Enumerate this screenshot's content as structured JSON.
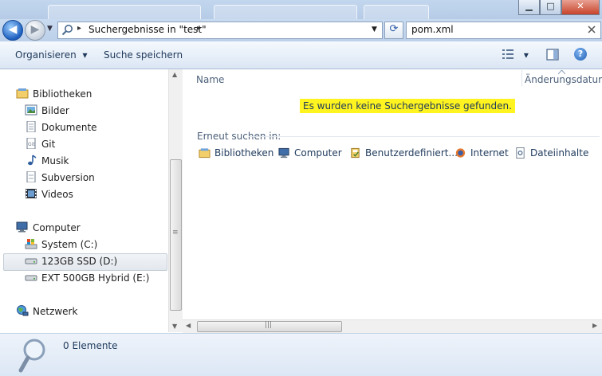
{
  "titlebar": {
    "window_controls": {
      "minimize": "▁",
      "maximize": "□",
      "close": "✕"
    }
  },
  "addressbar": {
    "back_glyph": "◀",
    "forward_glyph": "▶",
    "path_separator": "▸",
    "path": "Suchergebnisse in \"test\"",
    "path_tail": "▸",
    "dropdown_glyph": "▼",
    "refresh_glyph": "⟳",
    "search_query": "pom.xml"
  },
  "toolbar": {
    "organize": "Organisieren",
    "organize_caret": "▾",
    "save_search": "Suche speichern",
    "view_caret": "▾",
    "help": "?"
  },
  "nav": {
    "libraries": "Bibliotheken",
    "library_items": [
      "Bilder",
      "Dokumente",
      "Git",
      "Musik",
      "Subversion",
      "Videos"
    ],
    "computer": "Computer",
    "drives": [
      "System (C:)",
      "123GB SSD (D:)",
      "EXT 500GB Hybrid (E:)"
    ],
    "network": "Netzwerk",
    "scroll_grip": "≡"
  },
  "content": {
    "col_name": "Name",
    "col_date": "Änderungsdatum",
    "no_results": "Es wurden keine Suchergebnisse gefunden.",
    "search_again": "Erneut suchen in:",
    "search_again_items": [
      "Bibliotheken",
      "Computer",
      "Benutzerdefiniert...",
      "Internet",
      "Dateiinhalte"
    ],
    "hscroll_grip": "|||"
  },
  "details": {
    "count": "0 Elemente"
  },
  "colors": {
    "highlight": "#fff41f",
    "text": "#1e395b",
    "toolbar_top": "#f5f9fd",
    "toolbar_bottom": "#dbe6f4"
  }
}
